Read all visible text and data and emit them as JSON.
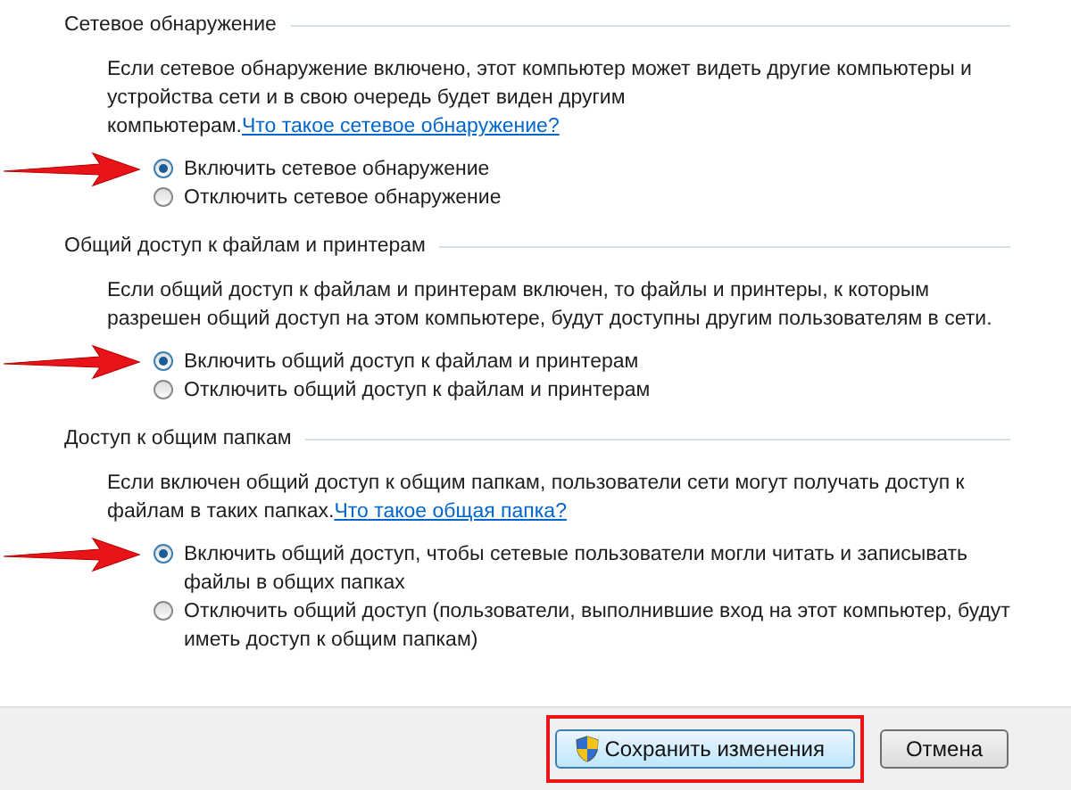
{
  "sections": [
    {
      "title": "Сетевое обнаружение",
      "text": "Если сетевое обнаружение включено, этот компьютер может видеть другие компьютеры и устройства сети и в свою очередь будет виден другим компьютерам.",
      "link": "Что такое сетевое обнаружение?",
      "options": [
        {
          "label": "Включить сетевое обнаружение",
          "selected": true,
          "arrow": true
        },
        {
          "label": "Отключить сетевое обнаружение",
          "selected": false,
          "arrow": false
        }
      ]
    },
    {
      "title": "Общий доступ к файлам и принтерам",
      "text": "Если общий доступ к файлам и принтерам включен, то файлы и принтеры, к которым разрешен общий доступ на этом компьютере, будут доступны другим пользователям в сети.",
      "options": [
        {
          "label": "Включить общий доступ к файлам и принтерам",
          "selected": true,
          "arrow": true
        },
        {
          "label": "Отключить общий доступ к файлам и принтерам",
          "selected": false,
          "arrow": false
        }
      ]
    },
    {
      "title": "Доступ к общим папкам",
      "text": "Если включен общий доступ к общим папкам, пользователи сети могут получать доступ к файлам в таких папках.",
      "link": "Что такое общая папка?",
      "options": [
        {
          "label": "Включить общий доступ, чтобы сетевые пользователи могли читать и записывать файлы в общих папках",
          "selected": true,
          "arrow": true
        },
        {
          "label": "Отключить общий доступ (пользователи, выполнившие вход на этот компьютер, будут иметь доступ к общим папкам)",
          "selected": false,
          "arrow": false
        }
      ]
    }
  ],
  "buttons": [
    {
      "label": "Сохранить изменения",
      "kind": "shield",
      "highlighted": true
    },
    {
      "label": "Отмена",
      "kind": "plain",
      "highlighted": false
    }
  ]
}
